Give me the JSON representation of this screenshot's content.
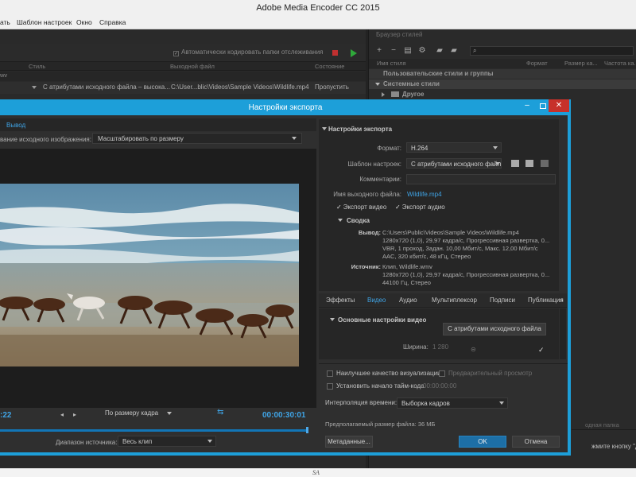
{
  "app": {
    "title": "Adobe Media Encoder CC 2015",
    "menu": [
      "ать",
      "Шаблон настроек",
      "Окно",
      "Справка"
    ]
  },
  "queue": {
    "auto_encode_label": "Автоматически кодировать папки отслеживания",
    "headers": [
      "Стиль",
      "Выходной файл",
      "Состояние"
    ],
    "parent_row": "wv",
    "row": {
      "style": "С атрибутами исходного файла – высока...",
      "output": "C:\\User...blic\\Videos\\Sample Videos\\Wildlife.mp4",
      "status": "Пропустить"
    }
  },
  "browser": {
    "tab_label": "Браузер стилей",
    "headers": [
      "Имя стиля",
      "Формат",
      "Размер ка...",
      "Частота ка..."
    ],
    "group_user": "Пользовательские стили и группы",
    "group_system": "Системные стили",
    "other_folder": "Другое",
    "watch_label": "одная папка",
    "watch_hint": "жмите кнопку \"Добав"
  },
  "dialog": {
    "title": "Настройки экспорта",
    "left": {
      "tab_output": "Вывод",
      "scale_label": "вание исходного изображения:",
      "scale_value": "Масштабировать по размеру",
      "timecode_current": ":22",
      "timecode_end": "00:00:30:01",
      "fit_value": "По размеру кадра",
      "range_label": "Диапазон источника:",
      "range_value": "Весь клип",
      "progress": 0.99
    },
    "settings": {
      "section_title": "Настройки экспорта",
      "format_label": "Формат:",
      "format_value": "H.264",
      "preset_label": "Шаблон настроек:",
      "preset_value": "С атрибутами исходного файл",
      "comments_label": "Комментарии:",
      "output_name_label": "Имя выходного файла:",
      "output_name_value": "Wildlife.mp4",
      "export_video_label": "Экспорт видео",
      "export_audio_label": "Экспорт аудио",
      "summary_title": "Сводка",
      "output_label": "Вывод:",
      "output_lines": [
        "C:\\Users\\Public\\Videos\\Sample Videos\\Wildlife.mp4",
        "1280x720 (1,0), 29,97 кадра/с, Прогрессивная развертка, 0...",
        "VBR, 1 проход, Задан. 10,00 Мбит/с, Макс. 12,00 Мбит/с",
        "AAC, 320 кбит/с, 48 кГц, Стерео"
      ],
      "source_label": "Источник:",
      "source_lines": [
        "Клип, Wildlife.wmv",
        "1280x720 (1,0), 29,97 кадра/с, Прогрессивная развертка, 0...",
        "44100 Гц, Стерео"
      ]
    },
    "tabs": [
      "Эффекты",
      "Видео",
      "Аудио",
      "Мультиплексор",
      "Подписи",
      "Публикация"
    ],
    "tabs_more": "»",
    "video": {
      "section_title": "Основные настройки видео",
      "match_source_btn": "С атрибутами исходного файла",
      "width_label": "Ширина:",
      "width_value": "1 280"
    },
    "bottom": {
      "max_quality_label": "Наилучшее качество визуализации",
      "preview_label": "Предварительный просмотр",
      "timecode_start_label": "Установить начало тайм-кода",
      "timecode_start_value": "00:00:00:00",
      "interp_label": "Интерполяция времени:",
      "interp_value": "Выборка кадров",
      "file_size": "Предполагаемый размер файла:  36 МБ",
      "metadata_btn": "Метаданные...",
      "ok_btn": "OK",
      "cancel_btn": "Отмена"
    }
  },
  "watermark": "SA"
}
